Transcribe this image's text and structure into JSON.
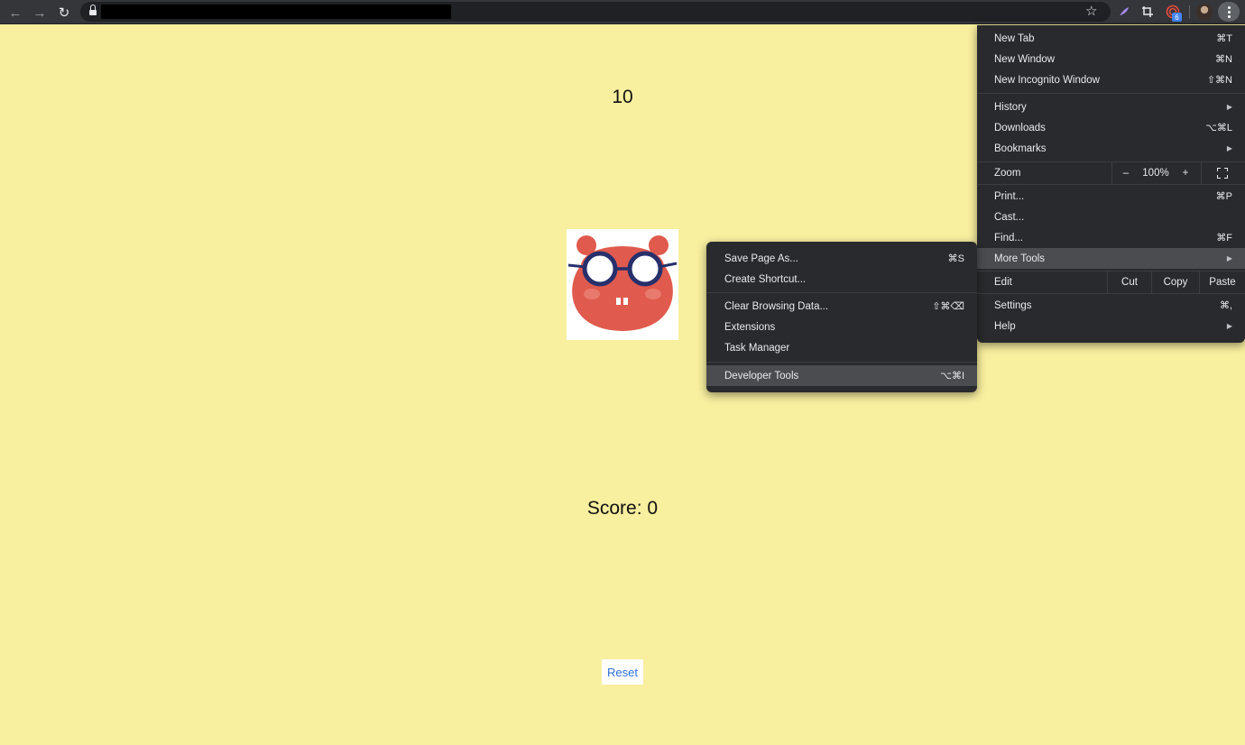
{
  "browser": {
    "back_icon": "←",
    "forward_icon": "→",
    "reload_icon": "↻",
    "bookmark_icon": "☆",
    "extension_badge": "6"
  },
  "game": {
    "timer": "10",
    "score_label": "Score:",
    "score_value": "0",
    "reset_label": "Reset"
  },
  "main_menu": {
    "new_tab": {
      "label": "New Tab",
      "shortcut": "⌘T"
    },
    "new_window": {
      "label": "New Window",
      "shortcut": "⌘N"
    },
    "new_incognito": {
      "label": "New Incognito Window",
      "shortcut": "⇧⌘N"
    },
    "history": {
      "label": "History"
    },
    "downloads": {
      "label": "Downloads",
      "shortcut": "⌥⌘L"
    },
    "bookmarks": {
      "label": "Bookmarks"
    },
    "zoom": {
      "label": "Zoom",
      "minus": "–",
      "value": "100%",
      "plus": "+"
    },
    "print": {
      "label": "Print...",
      "shortcut": "⌘P"
    },
    "cast": {
      "label": "Cast..."
    },
    "find": {
      "label": "Find...",
      "shortcut": "⌘F"
    },
    "more_tools": {
      "label": "More Tools"
    },
    "edit": {
      "label": "Edit",
      "cut": "Cut",
      "copy": "Copy",
      "paste": "Paste"
    },
    "settings": {
      "label": "Settings",
      "shortcut": "⌘,"
    },
    "help": {
      "label": "Help"
    }
  },
  "sub_menu": {
    "save_page": {
      "label": "Save Page As...",
      "shortcut": "⌘S"
    },
    "create_shortcut": {
      "label": "Create Shortcut..."
    },
    "clear_data": {
      "label": "Clear Browsing Data...",
      "shortcut": "⇧⌘⌫"
    },
    "extensions": {
      "label": "Extensions"
    },
    "task_manager": {
      "label": "Task Manager"
    },
    "dev_tools": {
      "label": "Developer Tools",
      "shortcut": "⌥⌘I"
    }
  },
  "colors": {
    "page_bg": "#f8ef9f",
    "mole": "#e05a4e",
    "glasses": "#27306b",
    "menu_bg": "#292a2d",
    "highlight": "#4a4c50",
    "reset_text": "#2f6fd8"
  }
}
